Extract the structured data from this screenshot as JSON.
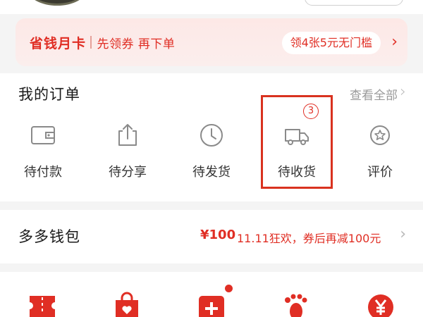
{
  "colors": {
    "brand_red": "#e02e24",
    "highlight": "#d9321f",
    "promo_bg": "#fde8e6"
  },
  "promo": {
    "title": "省钱月卡",
    "subtitle": "先领券 再下单",
    "pill": "领4张5元无门槛",
    "arrow_icon": "chevron-right-icon"
  },
  "orders": {
    "title": "我的订单",
    "view_all": "查看全部",
    "items": [
      {
        "label": "待付款",
        "icon": "wallet-icon"
      },
      {
        "label": "待分享",
        "icon": "share-icon"
      },
      {
        "label": "待发货",
        "icon": "clock-icon"
      },
      {
        "label": "待收货",
        "icon": "truck-icon",
        "badge": "3",
        "highlighted": true
      },
      {
        "label": "评价",
        "icon": "review-star-icon"
      }
    ]
  },
  "wallet": {
    "title": "多多钱包",
    "amount": "¥100",
    "promo_text": "11.11狂欢，券后再减100元"
  },
  "tools": [
    {
      "icon": "ticket-icon"
    },
    {
      "icon": "shopping-bag-heart-icon"
    },
    {
      "icon": "medical-plus-icon",
      "dot": true
    },
    {
      "icon": "footprint-icon"
    },
    {
      "icon": "yuan-coin-icon"
    }
  ]
}
